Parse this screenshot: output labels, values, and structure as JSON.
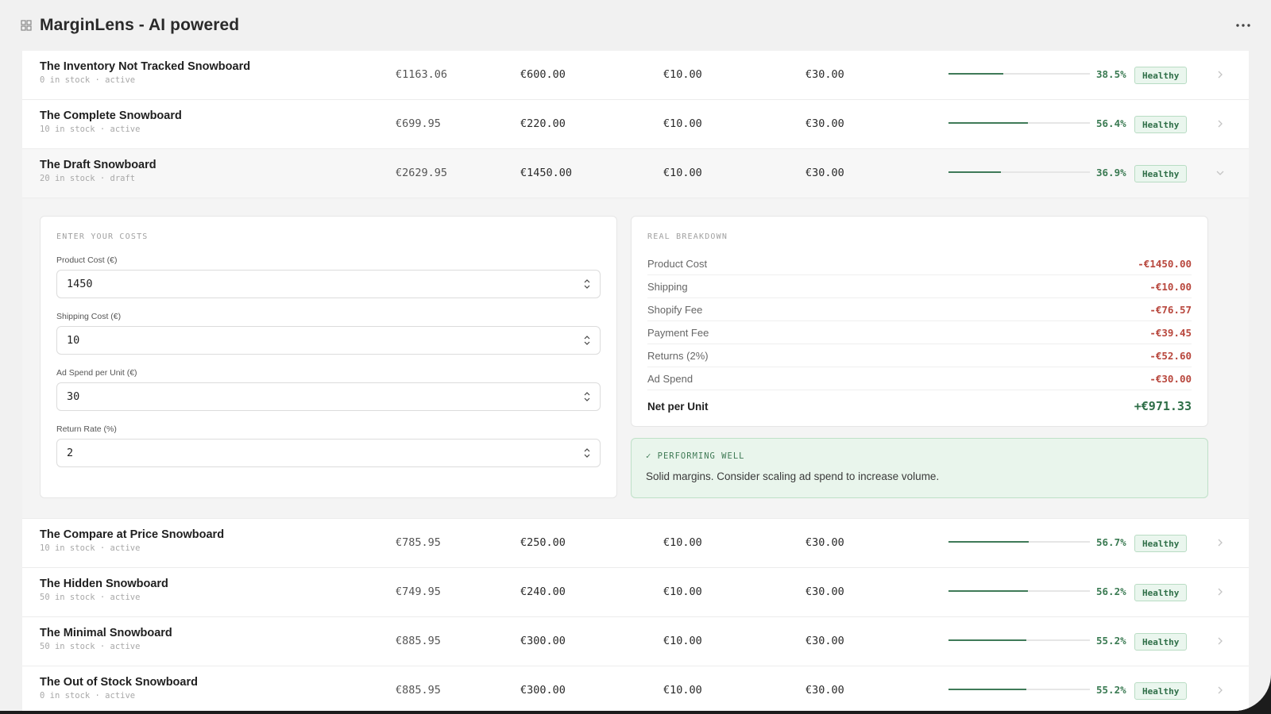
{
  "app": {
    "title": "MarginLens - AI powered"
  },
  "products_before": [
    {
      "name": "The Inventory Not Tracked Snowboard",
      "sub": "0 in stock · active",
      "price": "€1163.06",
      "cost": "€600.00",
      "shipping": "€10.00",
      "ad": "€30.00",
      "margin": "38.5%",
      "margin_value": 38.5,
      "status": "Healthy"
    },
    {
      "name": "The Complete Snowboard",
      "sub": "10 in stock · active",
      "price": "€699.95",
      "cost": "€220.00",
      "shipping": "€10.00",
      "ad": "€30.00",
      "margin": "56.4%",
      "margin_value": 56.4,
      "status": "Healthy"
    }
  ],
  "selected_product": {
    "name": "The Draft Snowboard",
    "sub": "20 in stock · draft",
    "price": "€2629.95",
    "cost": "€1450.00",
    "shipping": "€10.00",
    "ad": "€30.00",
    "margin": "36.9%",
    "margin_value": 36.9,
    "status": "Healthy"
  },
  "costs_form": {
    "title": "ENTER YOUR COSTS",
    "product_cost_label": "Product Cost (€)",
    "product_cost_value": "1450",
    "shipping_cost_label": "Shipping Cost (€)",
    "shipping_cost_value": "10",
    "ad_spend_label": "Ad Spend per Unit (€)",
    "ad_spend_value": "30",
    "return_rate_label": "Return Rate (%)",
    "return_rate_value": "2"
  },
  "breakdown": {
    "title": "REAL BREAKDOWN",
    "rows": [
      {
        "label": "Product Cost",
        "value": "-€1450.00"
      },
      {
        "label": "Shipping",
        "value": "-€10.00"
      },
      {
        "label": "Shopify Fee",
        "value": "-€76.57"
      },
      {
        "label": "Payment Fee",
        "value": "-€39.45"
      },
      {
        "label": "Returns (2%)",
        "value": "-€52.60"
      },
      {
        "label": "Ad Spend",
        "value": "-€30.00"
      }
    ],
    "net_label": "Net per Unit",
    "net_value": "+€971.33"
  },
  "notice": {
    "title": "✓ PERFORMING WELL",
    "text": "Solid margins. Consider scaling ad spend to increase volume."
  },
  "products_after": [
    {
      "name": "The Compare at Price Snowboard",
      "sub": "10 in stock · active",
      "price": "€785.95",
      "cost": "€250.00",
      "shipping": "€10.00",
      "ad": "€30.00",
      "margin": "56.7%",
      "margin_value": 56.7,
      "status": "Healthy"
    },
    {
      "name": "The Hidden Snowboard",
      "sub": "50 in stock · active",
      "price": "€749.95",
      "cost": "€240.00",
      "shipping": "€10.00",
      "ad": "€30.00",
      "margin": "56.2%",
      "margin_value": 56.2,
      "status": "Healthy"
    },
    {
      "name": "The Minimal Snowboard",
      "sub": "50 in stock · active",
      "price": "€885.95",
      "cost": "€300.00",
      "shipping": "€10.00",
      "ad": "€30.00",
      "margin": "55.2%",
      "margin_value": 55.2,
      "status": "Healthy"
    },
    {
      "name": "The Out of Stock Snowboard",
      "sub": "0 in stock · active",
      "price": "€885.95",
      "cost": "€300.00",
      "shipping": "€10.00",
      "ad": "€30.00",
      "margin": "55.2%",
      "margin_value": 55.2,
      "status": "Healthy"
    }
  ],
  "colors": {
    "accent_green": "#3f7a58",
    "negative_red": "#b8473d",
    "badge_bg": "#eaf6ee"
  }
}
